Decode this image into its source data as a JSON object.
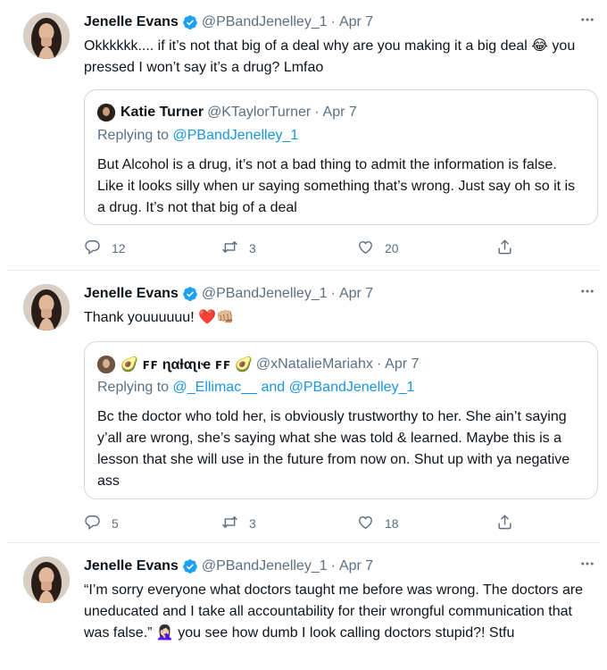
{
  "colors": {
    "accent": "#1da1f2",
    "text": "#0f1419",
    "muted": "#5b7083",
    "border": "#cfd9de",
    "heart": "#e0245e"
  },
  "tweets": [
    {
      "name": "Jenelle Evans",
      "handle": "@PBandJenelley_1",
      "date": "Apr 7",
      "text": "Okkkkkk.... if it’s not that big of a deal why are you making it a big deal 😂 you pressed I won’t say it’s a drug? Lmfao",
      "quote": {
        "name": "Katie Turner",
        "handle": "@KTaylorTurner",
        "date": "Apr 7",
        "replying_prefix": "Replying to ",
        "replying_to": "@PBandJenelley_1",
        "text": "But Alcohol is a drug, it’s not a bad thing to admit the information is false. Like it looks silly when ur saying something that’s wrong. Just say oh so it is a drug. It’s not that big of a deal"
      },
      "replies": "12",
      "retweets": "3",
      "likes": "20"
    },
    {
      "name": "Jenelle Evans",
      "handle": "@PBandJenelley_1",
      "date": "Apr 7",
      "text": "Thank youuuuuu! ❤️👊🏼",
      "quote": {
        "name": "🥑 ꜰꜰ ɳαƚαʅιҽ ꜰꜰ 🥑",
        "handle": "@xNatalieMariahx",
        "date": "Apr 7",
        "replying_prefix": "Replying to ",
        "replying_to": "@_Ellimac__ and @PBandJenelley_1",
        "text": "Bc the doctor who told her, is obviously trustworthy to her. She ain’t saying y’all are wrong, she’s saying what she was told & learned. Maybe this is a lesson that she will use in the future from now on. Shut up with ya negative ass"
      },
      "replies": "5",
      "retweets": "3",
      "likes": "18"
    },
    {
      "name": "Jenelle Evans",
      "handle": "@PBandJenelley_1",
      "date": "Apr 7",
      "text": "“I’m sorry everyone what doctors taught me before was wrong. The doctors are uneducated and I take all accountability for their wrongful communication that was false.” 🤦🏻‍♀️ you see how dumb I look calling doctors stupid?! Stfu"
    }
  ],
  "separator": "·"
}
